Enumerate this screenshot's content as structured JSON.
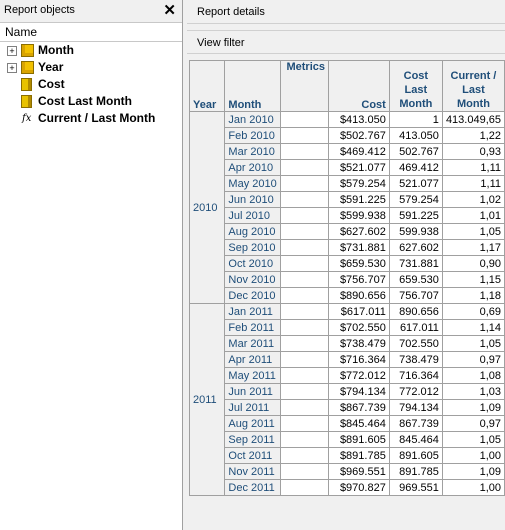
{
  "left_panel": {
    "title": "Report objects",
    "close_glyph": "✕",
    "column_header": "Name",
    "items": [
      {
        "label": "Month",
        "icon": "attribute-cube-icon",
        "expandable": true,
        "expander": "+"
      },
      {
        "label": "Year",
        "icon": "attribute-cube-icon",
        "expandable": true,
        "expander": "+"
      },
      {
        "label": "Cost",
        "icon": "metric-icon",
        "expandable": false
      },
      {
        "label": "Cost Last Month",
        "icon": "metric-icon",
        "expandable": false
      },
      {
        "label": "Current / Last Month",
        "icon": "fx-icon",
        "glyph": "fx",
        "expandable": false
      }
    ]
  },
  "right_panel": {
    "report_details_label": "Report details",
    "view_filter_label": "View filter"
  },
  "grid": {
    "headers": {
      "year": "Year",
      "month": "Month",
      "metrics": "Metrics",
      "cost": "Cost",
      "cost_last_month": "Cost Last Month",
      "ratio": "Current / Last Month"
    },
    "groups": [
      {
        "year": "2010",
        "rows": [
          {
            "month": "Jan 2010",
            "cost": "$413.050",
            "clm": "1",
            "ratio": "413.049,65"
          },
          {
            "month": "Feb 2010",
            "cost": "$502.767",
            "clm": "413.050",
            "ratio": "1,22"
          },
          {
            "month": "Mar 2010",
            "cost": "$469.412",
            "clm": "502.767",
            "ratio": "0,93"
          },
          {
            "month": "Apr 2010",
            "cost": "$521.077",
            "clm": "469.412",
            "ratio": "1,11"
          },
          {
            "month": "May 2010",
            "cost": "$579.254",
            "clm": "521.077",
            "ratio": "1,11"
          },
          {
            "month": "Jun 2010",
            "cost": "$591.225",
            "clm": "579.254",
            "ratio": "1,02"
          },
          {
            "month": "Jul 2010",
            "cost": "$599.938",
            "clm": "591.225",
            "ratio": "1,01"
          },
          {
            "month": "Aug 2010",
            "cost": "$627.602",
            "clm": "599.938",
            "ratio": "1,05"
          },
          {
            "month": "Sep 2010",
            "cost": "$731.881",
            "clm": "627.602",
            "ratio": "1,17"
          },
          {
            "month": "Oct 2010",
            "cost": "$659.530",
            "clm": "731.881",
            "ratio": "0,90"
          },
          {
            "month": "Nov 2010",
            "cost": "$756.707",
            "clm": "659.530",
            "ratio": "1,15"
          },
          {
            "month": "Dec 2010",
            "cost": "$890.656",
            "clm": "756.707",
            "ratio": "1,18"
          }
        ]
      },
      {
        "year": "2011",
        "rows": [
          {
            "month": "Jan 2011",
            "cost": "$617.011",
            "clm": "890.656",
            "ratio": "0,69"
          },
          {
            "month": "Feb 2011",
            "cost": "$702.550",
            "clm": "617.011",
            "ratio": "1,14"
          },
          {
            "month": "Mar 2011",
            "cost": "$738.479",
            "clm": "702.550",
            "ratio": "1,05"
          },
          {
            "month": "Apr 2011",
            "cost": "$716.364",
            "clm": "738.479",
            "ratio": "0,97"
          },
          {
            "month": "May 2011",
            "cost": "$772.012",
            "clm": "716.364",
            "ratio": "1,08"
          },
          {
            "month": "Jun 2011",
            "cost": "$794.134",
            "clm": "772.012",
            "ratio": "1,03"
          },
          {
            "month": "Jul 2011",
            "cost": "$867.739",
            "clm": "794.134",
            "ratio": "1,09"
          },
          {
            "month": "Aug 2011",
            "cost": "$845.464",
            "clm": "867.739",
            "ratio": "0,97"
          },
          {
            "month": "Sep 2011",
            "cost": "$891.605",
            "clm": "845.464",
            "ratio": "1,05"
          },
          {
            "month": "Oct 2011",
            "cost": "$891.785",
            "clm": "891.605",
            "ratio": "1,00"
          },
          {
            "month": "Nov 2011",
            "cost": "$969.551",
            "clm": "891.785",
            "ratio": "1,09"
          },
          {
            "month": "Dec 2011",
            "cost": "$970.827",
            "clm": "969.551",
            "ratio": "1,00"
          }
        ]
      }
    ]
  }
}
